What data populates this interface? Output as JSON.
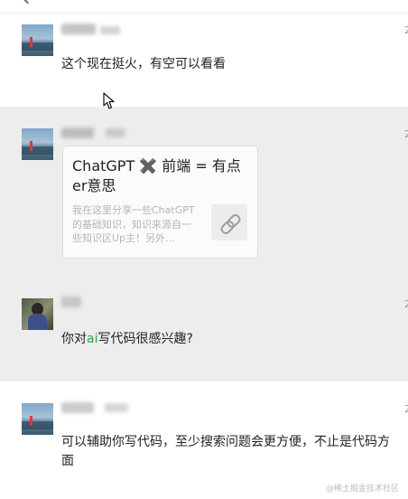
{
  "messages": [
    {
      "text": "这个现在挺火，有空可以看看",
      "timestamp": "2"
    },
    {
      "timestamp": "2",
      "card": {
        "title": "ChatGPT ✖️ 前端 = 有点er意思",
        "description": "我在这里分享一些ChatGPT的基础知识，知识来源自一些知识区Up主！另外..."
      },
      "icons": [
        "link-icon"
      ]
    },
    {
      "timestamp": "2",
      "text_before": "你对",
      "highlight": "ai",
      "text_after": "写代码很感兴趣?"
    },
    {
      "text": "可以辅助你写代码，至少搜索问题会更方便，不止是代码方面",
      "timestamp": "2"
    }
  ],
  "watermark": "@稀土掘金技术社区",
  "colors": {
    "shaded_background": "#ededed",
    "highlight": "#2ea043",
    "muted_text": "#b5b5b5"
  },
  "icons": [
    "back-icon",
    "mouse-cursor-icon",
    "link-icon"
  ]
}
